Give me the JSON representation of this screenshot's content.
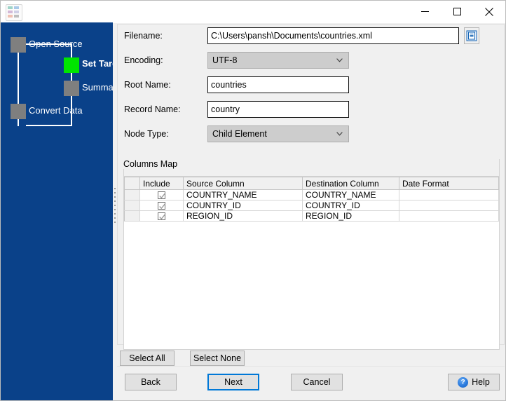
{
  "window": {
    "title": "",
    "app_icon": "grid-app-icon",
    "minimize_label": "Minimize",
    "maximize_label": "Maximize",
    "close_label": "Close"
  },
  "colors": {
    "sidebar_bg": "#0a4189",
    "step_inactive": "#7f7f7f",
    "step_active": "#00e500",
    "accent": "#0078d7",
    "panel_bg": "#f0f0f0"
  },
  "sidebar": {
    "steps": [
      {
        "label": "Open Source",
        "state": "inactive"
      },
      {
        "label": "Set Target",
        "state": "active"
      },
      {
        "label": "Summary",
        "state": "inactive"
      },
      {
        "label": "Convert Data",
        "state": "inactive"
      }
    ]
  },
  "form": {
    "filename": {
      "label": "Filename:",
      "value": "C:\\Users\\pansh\\Documents\\countries.xml",
      "placeholder": "",
      "browse_icon": "file-browse-icon"
    },
    "encoding": {
      "label": "Encoding:",
      "value": "UTF-8",
      "options": [
        "UTF-8"
      ]
    },
    "root_name": {
      "label": "Root Name:",
      "value": "countries",
      "placeholder": ""
    },
    "record_name": {
      "label": "Record Name:",
      "value": "country",
      "placeholder": ""
    },
    "node_type": {
      "label": "Node Type:",
      "value": "Child Element",
      "options": [
        "Child Element"
      ]
    }
  },
  "columns_map": {
    "title": "Columns Map",
    "headers": [
      "",
      "Include",
      "Source Column",
      "Destination Column",
      "Date Format"
    ],
    "rows": [
      {
        "include": true,
        "source": "COUNTRY_NAME",
        "destination": "COUNTRY_NAME",
        "date_format": ""
      },
      {
        "include": true,
        "source": "COUNTRY_ID",
        "destination": "COUNTRY_ID",
        "date_format": ""
      },
      {
        "include": true,
        "source": "REGION_ID",
        "destination": "REGION_ID",
        "date_format": ""
      }
    ],
    "select_all_label": "Select All",
    "select_none_label": "Select None"
  },
  "footer": {
    "back_label": "Back",
    "next_label": "Next",
    "cancel_label": "Cancel",
    "help_label": "Help",
    "help_icon_glyph": "?"
  }
}
